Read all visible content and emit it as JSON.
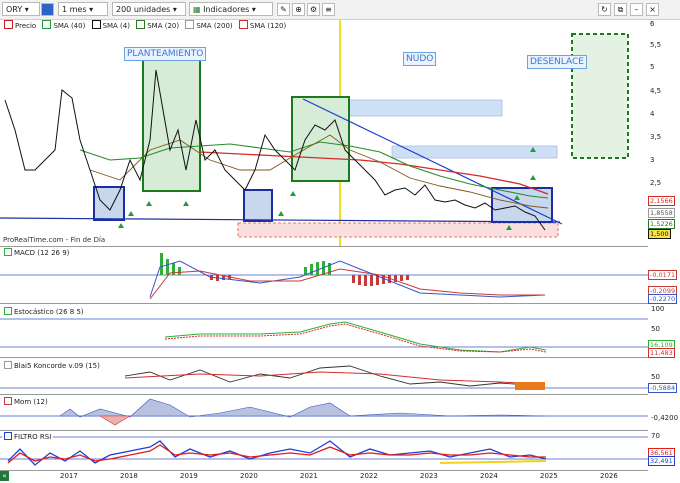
{
  "toolbar": {
    "symbol": "ORY",
    "period": "1 mes",
    "units": "200 unidades",
    "indicators": "Indicadores"
  },
  "legend": {
    "items": [
      {
        "label": "Precio",
        "color": "#c21f1f"
      },
      {
        "label": "SMA (40)",
        "color": "#1f9e3a"
      },
      {
        "label": "SMA (4)",
        "color": "#111111"
      },
      {
        "label": "SMA (20)",
        "color": "#2a7a2a"
      },
      {
        "label": "SMA (200)",
        "color": "#b4b4b4"
      },
      {
        "label": "SMA (120)",
        "color": "#d62b2b"
      }
    ]
  },
  "annotations": {
    "planteamiento": "PLANTEAMIENTO",
    "nudo": "NUDO",
    "desenlace": "DESENLACE"
  },
  "copyright": "ProRealTime.com - Fin de Día",
  "price_axis": {
    "ticks": [
      "6",
      "5,5",
      "5",
      "4,5",
      "4",
      "3,5",
      "3",
      "2,5"
    ],
    "tags": [
      {
        "text": "2,1566",
        "color": "#d62b2b"
      },
      {
        "text": "1,8558",
        "color": "#555555"
      },
      {
        "text": "1,5226",
        "color": "#2a7a2a"
      },
      {
        "text": "1,500",
        "color": "#111111"
      }
    ]
  },
  "panels": {
    "macd": {
      "label": "MACD (12 26 9)",
      "tags": [
        "-0,0171",
        "-0,2099",
        "-0,2270"
      ]
    },
    "stoch": {
      "label": "Estocástico (26 8 5)",
      "ticks": [
        "100",
        "50"
      ],
      "tags": [
        "16,109",
        "11,483"
      ]
    },
    "koncorde": {
      "label": "Blai5 Koncorde v.09 (15)",
      "ticks": [
        "50"
      ],
      "tags": [
        "-0,5884"
      ]
    },
    "mom": {
      "label": "Mom (12)",
      "ticks": [
        "-0,4200"
      ]
    },
    "rsi": {
      "label": "FILTRO RSI",
      "ticks": [
        "70"
      ],
      "tags": [
        "36,561",
        "32,491"
      ]
    }
  },
  "years": [
    "2017",
    "2018",
    "2019",
    "2020",
    "2021",
    "2022",
    "2023",
    "2024",
    "2025",
    "2026"
  ]
}
